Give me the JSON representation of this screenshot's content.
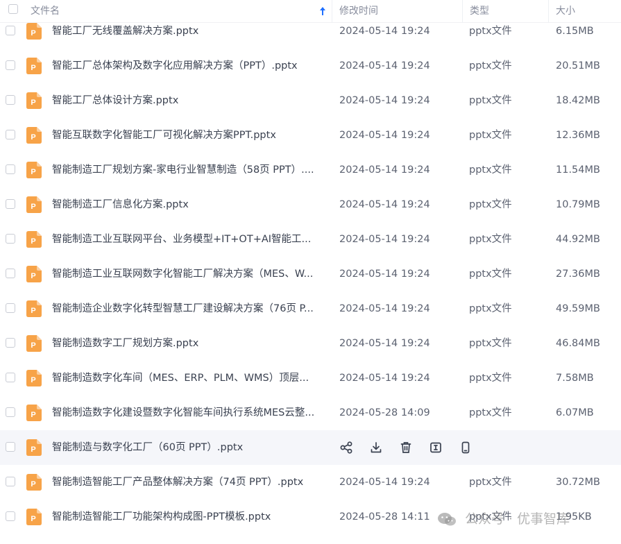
{
  "header": {
    "col_name": "文件名",
    "col_mtime": "修改时间",
    "col_type": "类型",
    "col_size": "大小"
  },
  "accent_color": "#1e6fff",
  "file_icon_color": "#f7a348",
  "files": [
    {
      "name": "智能工厂无线覆盖解决方案.pptx",
      "mtime": "2024-05-14 19:24",
      "type": "pptx文件",
      "size": "6.15MB"
    },
    {
      "name": "智能工厂总体架构及数字化应用解决方案（PPT）.pptx",
      "mtime": "2024-05-14 19:24",
      "type": "pptx文件",
      "size": "20.51MB"
    },
    {
      "name": "智能工厂总体设计方案.pptx",
      "mtime": "2024-05-14 19:24",
      "type": "pptx文件",
      "size": "18.42MB"
    },
    {
      "name": "智能互联数字化智能工厂可视化解决方案PPT.pptx",
      "mtime": "2024-05-14 19:24",
      "type": "pptx文件",
      "size": "12.36MB"
    },
    {
      "name": "智能制造工厂规划方案-家电行业智慧制造（58页 PPT）....",
      "mtime": "2024-05-14 19:24",
      "type": "pptx文件",
      "size": "11.54MB"
    },
    {
      "name": "智能制造工厂信息化方案.pptx",
      "mtime": "2024-05-14 19:24",
      "type": "pptx文件",
      "size": "10.79MB"
    },
    {
      "name": "智能制造工业互联网平台、业务模型+IT+OT+AI智能工...",
      "mtime": "2024-05-14 19:24",
      "type": "pptx文件",
      "size": "44.92MB"
    },
    {
      "name": "智能制造工业互联网数字化智能工厂解决方案（MES、W...",
      "mtime": "2024-05-14 19:24",
      "type": "pptx文件",
      "size": "27.36MB"
    },
    {
      "name": "智能制造企业数字化转型智慧工厂建设解决方案（76页 P...",
      "mtime": "2024-05-14 19:24",
      "type": "pptx文件",
      "size": "49.59MB"
    },
    {
      "name": "智能制造数字工厂规划方案.pptx",
      "mtime": "2024-05-14 19:24",
      "type": "pptx文件",
      "size": "46.84MB"
    },
    {
      "name": "智能制造数字化车间（MES、ERP、PLM、WMS）顶层...",
      "mtime": "2024-05-14 19:24",
      "type": "pptx文件",
      "size": "7.58MB"
    },
    {
      "name": "智能制造数字化建设暨数字化智能车间执行系统MES云整...",
      "mtime": "2024-05-28 14:09",
      "type": "pptx文件",
      "size": "6.07MB"
    },
    {
      "name": "智能制造与数字化工厂（60页 PPT）.pptx",
      "hovered": true
    },
    {
      "name": "智能制造智能工厂产品整体解决方案（74页 PPT）.pptx",
      "mtime": "2024-05-14 19:24",
      "type": "pptx文件",
      "size": "30.72MB"
    },
    {
      "name": "智能制造智能工厂功能架构构成图-PPT模板.pptx",
      "mtime": "2024-05-28 14:11",
      "type": "pptx文件",
      "size": "1.95KB"
    }
  ],
  "row_actions": [
    "share-icon",
    "download-icon",
    "delete-icon",
    "rename-icon",
    "mobile-icon"
  ],
  "watermark": {
    "text": "公众号 · 优事智库"
  }
}
